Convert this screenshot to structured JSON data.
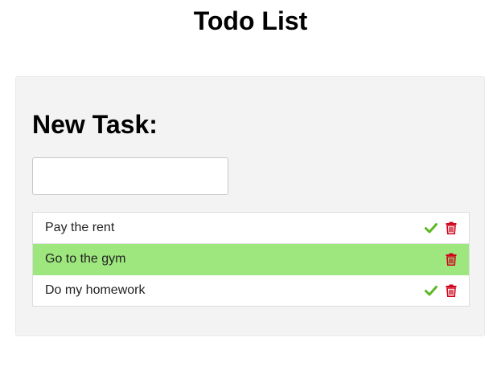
{
  "header": {
    "title": "Todo List"
  },
  "form": {
    "heading": "New Task:",
    "input_value": "",
    "input_placeholder": ""
  },
  "tasks": [
    {
      "label": "Pay the rent",
      "completed": false,
      "actions": [
        "check-icon",
        "trash-icon"
      ]
    },
    {
      "label": "Go to the gym",
      "completed": true,
      "actions": [
        "trash-icon"
      ]
    },
    {
      "label": "Do my homework",
      "completed": false,
      "actions": [
        "check-icon",
        "trash-icon"
      ]
    }
  ],
  "colors": {
    "completed_background": "#9de77e",
    "check_icon": "#5cb824",
    "trash_icon": "#d0021b",
    "card_background": "#f3f3f3"
  }
}
